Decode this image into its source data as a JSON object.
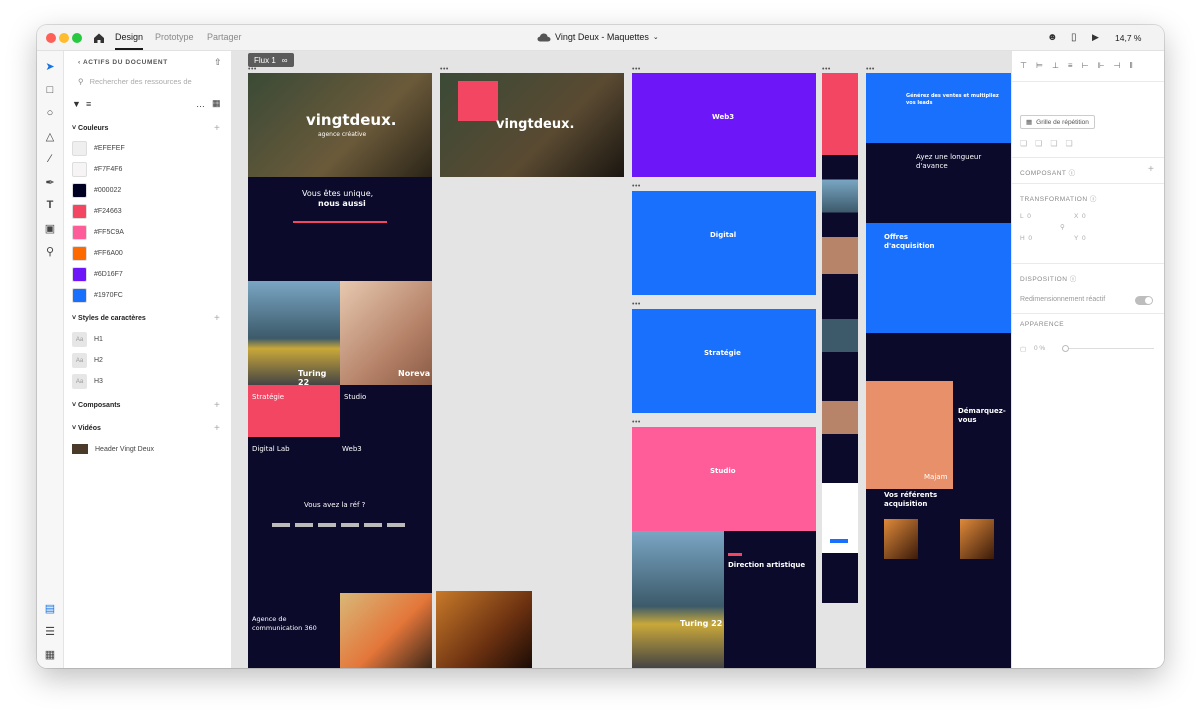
{
  "titlebar": {
    "tabs": [
      {
        "label": "Design",
        "active": true
      },
      {
        "label": "Prototype",
        "active": false
      },
      {
        "label": "Partager",
        "active": false
      }
    ],
    "doc_title": "Vingt Deux - Maquettes",
    "zoom": "14,7 %"
  },
  "assets": {
    "title": "ACTIFS DU DOCUMENT",
    "search_placeholder": "Rechercher des ressources de",
    "colors_label": "Couleurs",
    "colors": [
      "#EFEFEF",
      "#F7F4F6",
      "#000022",
      "#F24663",
      "#FF5C9A",
      "#FF6A00",
      "#6D16F7",
      "#1970FC"
    ],
    "char_styles_label": "Styles de caractères",
    "char_styles": [
      "H1",
      "H2",
      "H3"
    ],
    "components_label": "Composants",
    "videos_label": "Vidéos",
    "videos": [
      "Header Vingt Deux"
    ]
  },
  "canvas": {
    "flow_label": "Flux 1",
    "artboards": {
      "hero_logo": "vingtdeux.",
      "hero_sub": "agence créative",
      "unique_line1": "Vous êtes unique,",
      "unique_line2": "nous aussi",
      "turing": "Turing 22",
      "noreva": "Noreva",
      "strategie": "Stratégie",
      "studio": "Studio",
      "digital_lab": "Digital Lab",
      "web3": "Web3",
      "ref": "Vous avez la réf ?",
      "agence": "Agence de communication 360",
      "web3_title": "Web3",
      "digital_title": "Digital",
      "strategie_title": "Stratégie",
      "studio_title": "Studio",
      "direction": "Direction artistique",
      "turing2": "Turing 22",
      "ventes": "Générez des ventes et multipliez vos leads",
      "longueur": "Ayez une longueur d'avance",
      "offres": "Offres d'acquisition",
      "demarquez": "Démarquez-vous",
      "majam": "Majam",
      "referents": "Vos référents acquisition"
    }
  },
  "props": {
    "grid_repeat": "Grille de répétition",
    "composant": "COMPOSANT",
    "transformation": "TRANSFORMATION",
    "l": "L",
    "h": "H",
    "x": "X",
    "y": "Y",
    "zero": "0",
    "disposition": "DISPOSITION",
    "resize": "Redimensionnement réactif",
    "apparence": "APPARENCE",
    "opacity": "0 %"
  }
}
